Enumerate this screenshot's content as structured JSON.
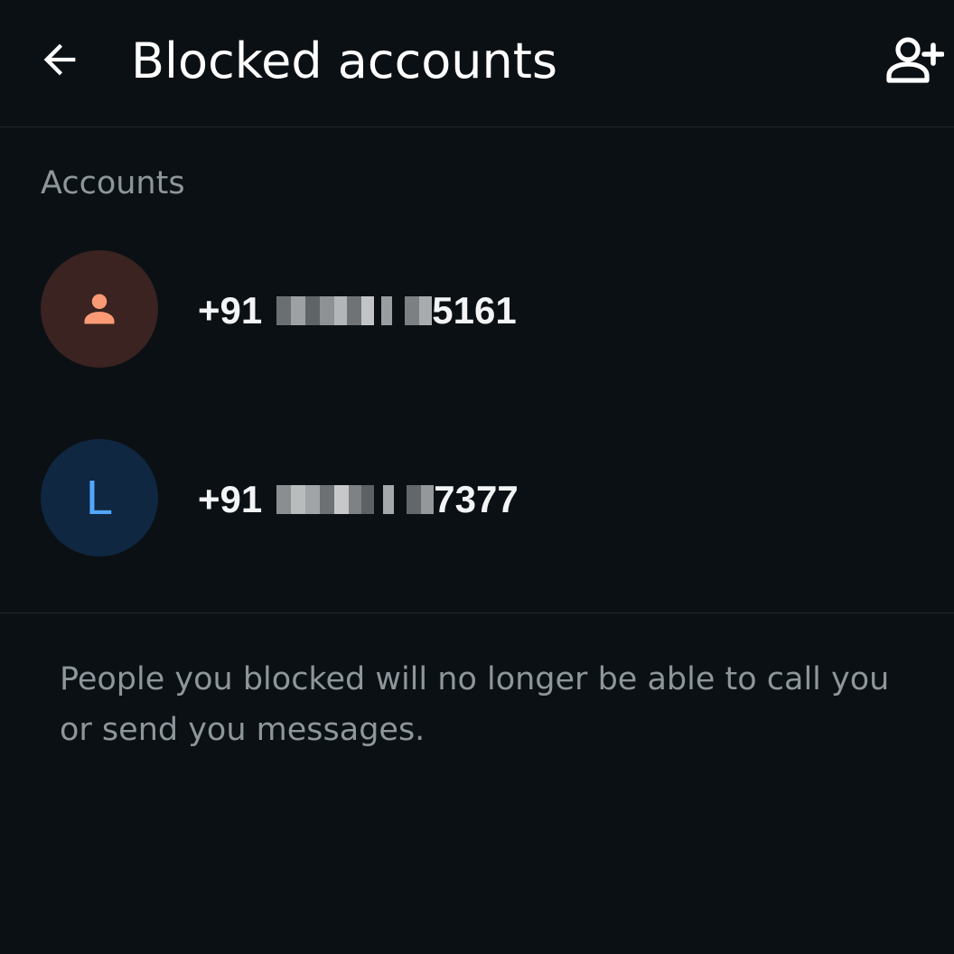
{
  "header": {
    "title": "Blocked accounts",
    "back_icon": "arrow-left-icon",
    "add_icon": "person-add-icon"
  },
  "section": {
    "label": "Accounts"
  },
  "accounts": [
    {
      "prefix": "+91",
      "suffix": "5161",
      "avatar_type": "person-icon",
      "avatar_bg": "#3a2320",
      "avatar_fg": "#fa9b76"
    },
    {
      "prefix": "+91",
      "suffix": "7377",
      "avatar_letter": "L",
      "avatar_bg": "#0f2741",
      "avatar_fg": "#53a6fd"
    }
  ],
  "footer": {
    "note": "People you blocked will no longer be able to call you or send you messages."
  }
}
